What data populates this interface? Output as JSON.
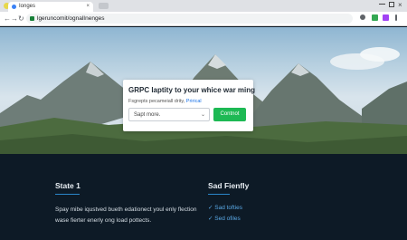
{
  "browser": {
    "tab_title": "Ionges",
    "tab_close": "×",
    "url": "lgeruncomit/ognalInenges",
    "nav_back": "←",
    "nav_forward": "→",
    "nav_reload": "↻",
    "win_close": "×"
  },
  "card": {
    "title": "GRPC laptity to your whice war ming",
    "subtitle": "Fsgrepts pecameiall drity,",
    "subtitle_link": "Prirical",
    "select_value": "Sapt more.",
    "select_caret": "⌄",
    "button_label": "Contnot"
  },
  "footer": {
    "left_title": "State 1",
    "left_text": "Spay mibe iqustved bueth edationect youl enly flection wase fierter enerly ong load pottects.",
    "right_title": "Sad Fienfly",
    "links": [
      "✓ Sad tofties",
      "✓ Sed ofiles"
    ]
  },
  "colors": {
    "accent_green": "#1db954",
    "link_blue": "#5aa9e6",
    "footer_bg": "#0d1a26"
  }
}
